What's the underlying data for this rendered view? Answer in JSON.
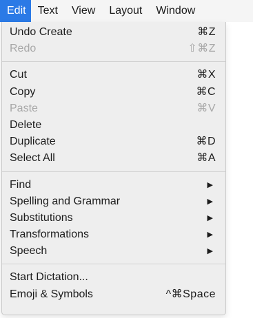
{
  "menubar": {
    "items": [
      "Edit",
      "Text",
      "View",
      "Layout",
      "Window"
    ]
  },
  "menu": {
    "group1": [
      {
        "label": "Undo Create",
        "shortcut": "⌘Z"
      },
      {
        "label": "Redo",
        "shortcut": "⇧⌘Z"
      }
    ],
    "group2": [
      {
        "label": "Cut",
        "shortcut": "⌘X"
      },
      {
        "label": "Copy",
        "shortcut": "⌘C"
      },
      {
        "label": "Paste",
        "shortcut": "⌘V"
      },
      {
        "label": "Delete",
        "shortcut": ""
      },
      {
        "label": "Duplicate",
        "shortcut": "⌘D"
      },
      {
        "label": "Select All",
        "shortcut": "⌘A"
      }
    ],
    "group3": [
      {
        "label": "Find",
        "arrow": "▶"
      },
      {
        "label": "Spelling and Grammar",
        "arrow": "▶"
      },
      {
        "label": "Substitutions",
        "arrow": "▶"
      },
      {
        "label": "Transformations",
        "arrow": "▶"
      },
      {
        "label": "Speech",
        "arrow": "▶"
      }
    ],
    "group4": [
      {
        "label": "Start Dictation...",
        "shortcut": ""
      },
      {
        "label": "Emoji & Symbols",
        "shortcut": "^⌘Space"
      }
    ]
  },
  "colors": {
    "accent": "#2b7ae6",
    "disabled_text": "#a8a8a8",
    "menu_bg": "#eeeeee"
  }
}
